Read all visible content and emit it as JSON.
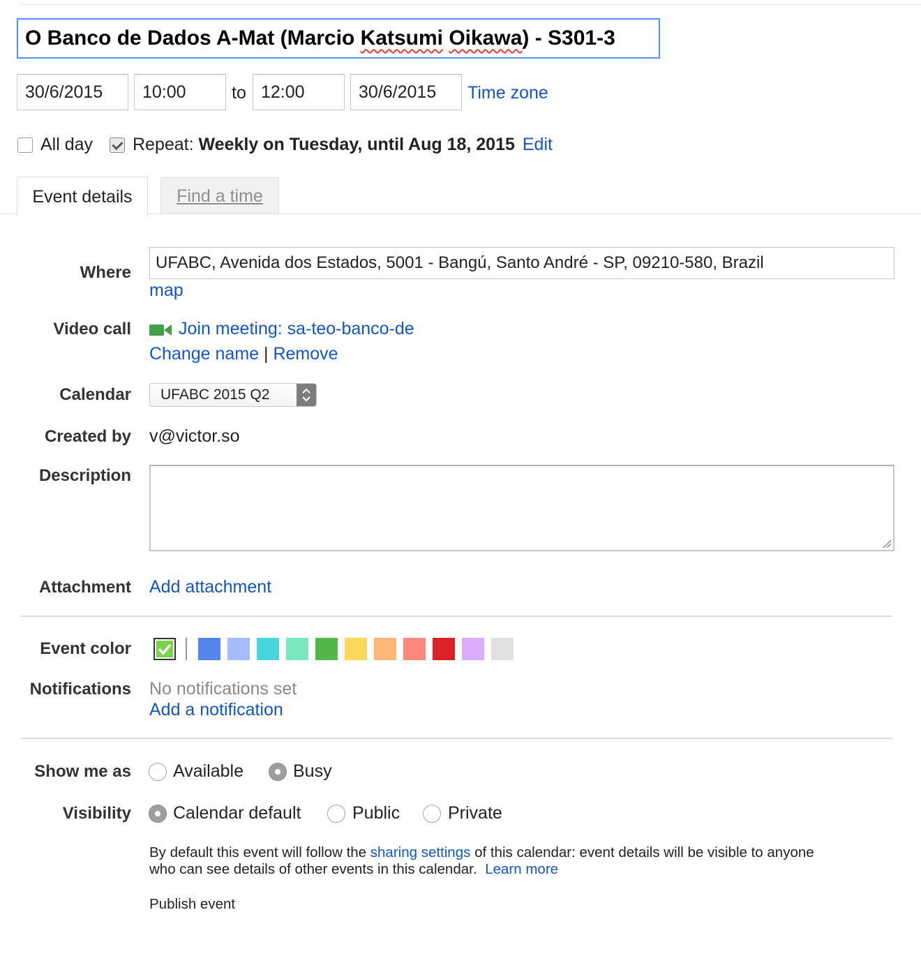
{
  "event": {
    "title": "O Banco de Dados A-Mat (Marcio ",
    "title_misspelled": "Katsumi",
    "title_mid": " ",
    "title_misspelled2": "Oikawa",
    "title_end": ") - S301-3"
  },
  "datetime": {
    "start_date": "30/6/2015",
    "start_time": "10:00",
    "to_label": "to",
    "end_time": "12:00",
    "end_date": "30/6/2015",
    "timezone_link": "Time zone"
  },
  "options": {
    "all_day_label": "All day",
    "all_day_checked": false,
    "repeat_checked": true,
    "repeat_prefix": "Repeat:",
    "repeat_summary": "Weekly on Tuesday, until Aug 18, 2015",
    "repeat_edit": "Edit"
  },
  "tabs": [
    {
      "label": "Event details",
      "active": true
    },
    {
      "label": "Find a time",
      "active": false
    }
  ],
  "details": {
    "where_label": "Where",
    "where_value": "UFABC, Avenida dos Estados, 5001 - Bangú, Santo André - SP, 09210-580, Brazil",
    "map_link": "map",
    "video_label": "Video call",
    "video_icon": "video-camera-icon",
    "join_link": "Join meeting: sa-teo-banco-de",
    "change_name": "Change name",
    "separator": "|",
    "remove": "Remove",
    "calendar_label": "Calendar",
    "calendar_value": "UFABC 2015 Q2",
    "created_label": "Created by",
    "created_value": "v@victor.so",
    "description_label": "Description",
    "description_value": "",
    "attachment_label": "Attachment",
    "attachment_link": "Add attachment"
  },
  "event_color": {
    "label": "Event color",
    "default_color": "#7bd148",
    "swatches": [
      "#5484ed",
      "#a4bdfc",
      "#46d6db",
      "#7ae7bf",
      "#51b749",
      "#fbd75b",
      "#ffb878",
      "#ff887c",
      "#dc2127",
      "#dbadff",
      "#e1e1e1"
    ]
  },
  "notifications": {
    "label": "Notifications",
    "none_text": "No notifications set",
    "add_link": "Add a notification"
  },
  "show_me_as": {
    "label": "Show me as",
    "options": [
      "Available",
      "Busy"
    ],
    "selected": "Busy"
  },
  "visibility": {
    "label": "Visibility",
    "options": [
      "Calendar default",
      "Public",
      "Private"
    ],
    "selected": "Calendar default",
    "info_1": "By default this event will follow the ",
    "sharing_link": "sharing settings",
    "info_2": " of this calendar: event details will be visible to anyone",
    "info_3": "who can see details of other events in this calendar.",
    "learn_more": "Learn more",
    "publish_link": "Publish event"
  }
}
